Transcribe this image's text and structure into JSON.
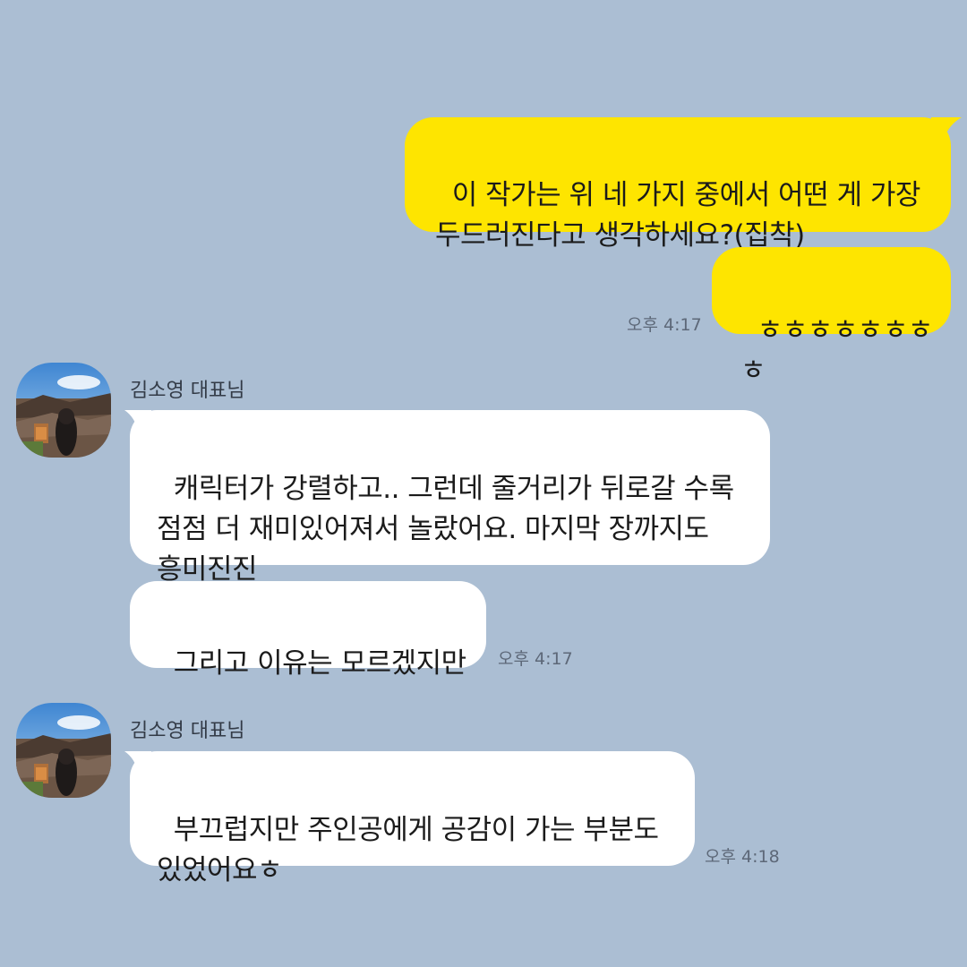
{
  "chat": {
    "background_color": "#abbed3",
    "my_bubble_color": "#fee500",
    "their_bubble_color": "#ffffff",
    "messages": [
      {
        "sender": "me",
        "text": "이 작가는 위 네 가지 중에서 어떤 게 가장\n두드러진다고 생각하세요?(집착)"
      },
      {
        "sender": "me",
        "text": "ㅎㅎㅎㅎㅎㅎㅎㅎ",
        "time": "오후 4:17"
      },
      {
        "sender": "김소영 대표님",
        "text": "캐릭터가 강렬하고.. 그런데 줄거리가 뒤로갈 수록\n점점 더 재미있어져서 놀랐어요. 마지막 장까지도\n흥미진진"
      },
      {
        "sender": "김소영 대표님",
        "text": "그리고 이유는 모르겠지만",
        "time": "오후 4:17"
      },
      {
        "sender": "김소영 대표님",
        "text": "부끄럽지만 주인공에게 공감이 가는 부분도\n있었어요ㅎ",
        "time": "오후 4:18"
      }
    ],
    "groups": [
      {
        "sender_name": "김소영 대표님",
        "avatar_icon": "profile-photo-hanok-rooftops"
      },
      {
        "sender_name": "김소영 대표님",
        "avatar_icon": "profile-photo-hanok-rooftops"
      }
    ]
  }
}
